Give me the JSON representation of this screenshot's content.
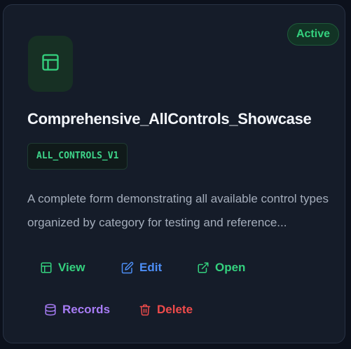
{
  "card": {
    "status": "Active",
    "title": "Comprehensive_AllControls_Showcase",
    "code": "ALL_CONTROLS_V1",
    "description": "A complete form demonstrating all available control types organized by category for testing and reference...",
    "icon": "layout-template-icon"
  },
  "actions": {
    "view_label": "View",
    "edit_label": "Edit",
    "open_label": "Open",
    "records_label": "Records",
    "delete_label": "Delete"
  },
  "colors": {
    "background": "#0c111c",
    "card": "#151c29",
    "green": "#34d17e",
    "blue": "#4d8ef5",
    "purple": "#a77cf5",
    "red": "#ef4b4b"
  }
}
